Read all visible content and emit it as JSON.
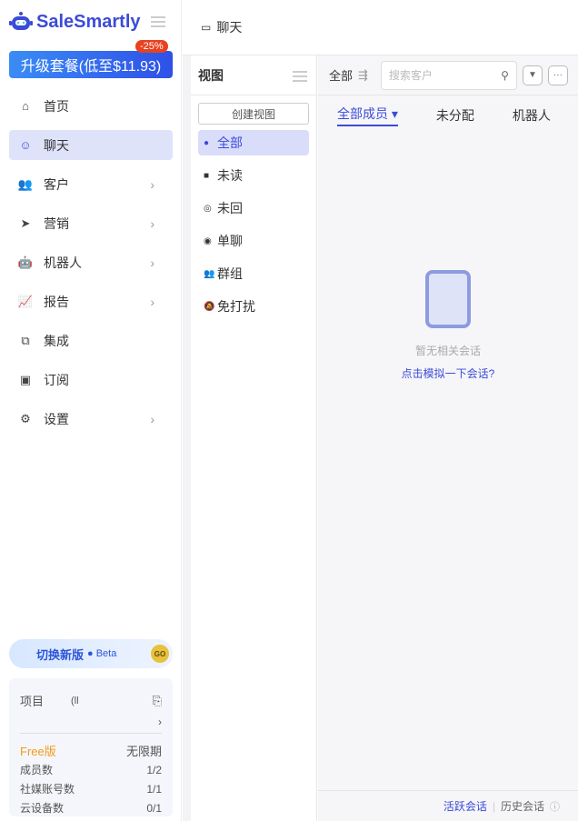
{
  "sidebar": {
    "brand": "SaleSmartly",
    "upgrade": "升级套餐(低至$11.93)",
    "discount": "-25%",
    "items": [
      {
        "label": "首页",
        "icon": "⌂"
      },
      {
        "label": "聊天",
        "icon": "☺"
      },
      {
        "label": "客户",
        "icon": "👥",
        "chev": "›"
      },
      {
        "label": "营销",
        "icon": "➤",
        "chev": "›"
      },
      {
        "label": "机器人",
        "icon": "🤖",
        "chev": "›"
      },
      {
        "label": "报告",
        "icon": "📈",
        "chev": "›"
      },
      {
        "label": "集成",
        "icon": "⧉"
      },
      {
        "label": "订阅",
        "icon": "▣"
      },
      {
        "label": "设置",
        "icon": "⚙",
        "chev": "›"
      }
    ],
    "beta": {
      "label": "切换新版",
      "tag": "● Beta",
      "go": "GO"
    },
    "project": {
      "label": "项目",
      "value": "(ll",
      "plan": "Free版",
      "expiry": "无限期",
      "stats": [
        {
          "k": "成员数",
          "v": "1/2"
        },
        {
          "k": "社媒账号数",
          "v": "1/1"
        },
        {
          "k": "云设备数",
          "v": "0/1"
        }
      ]
    }
  },
  "header": {
    "title": "聊天"
  },
  "views": {
    "title": "视图",
    "create": "创建视图",
    "items": [
      {
        "label": "全部",
        "icon": "●"
      },
      {
        "label": "未读",
        "icon": "■"
      },
      {
        "label": "未回",
        "icon": "◎"
      },
      {
        "label": "单聊",
        "icon": "◉"
      },
      {
        "label": "群组",
        "icon": "👥"
      },
      {
        "label": "免打扰",
        "icon": "🔕"
      }
    ]
  },
  "main": {
    "filter": "全部",
    "search_placeholder": "搜索客户",
    "tabs": [
      "全部成员 ▾",
      "未分配",
      "机器人"
    ],
    "empty": "暂无相关会话",
    "simulate": "点击模拟一下会话?",
    "active": "活跃会话",
    "history": "历史会话"
  }
}
